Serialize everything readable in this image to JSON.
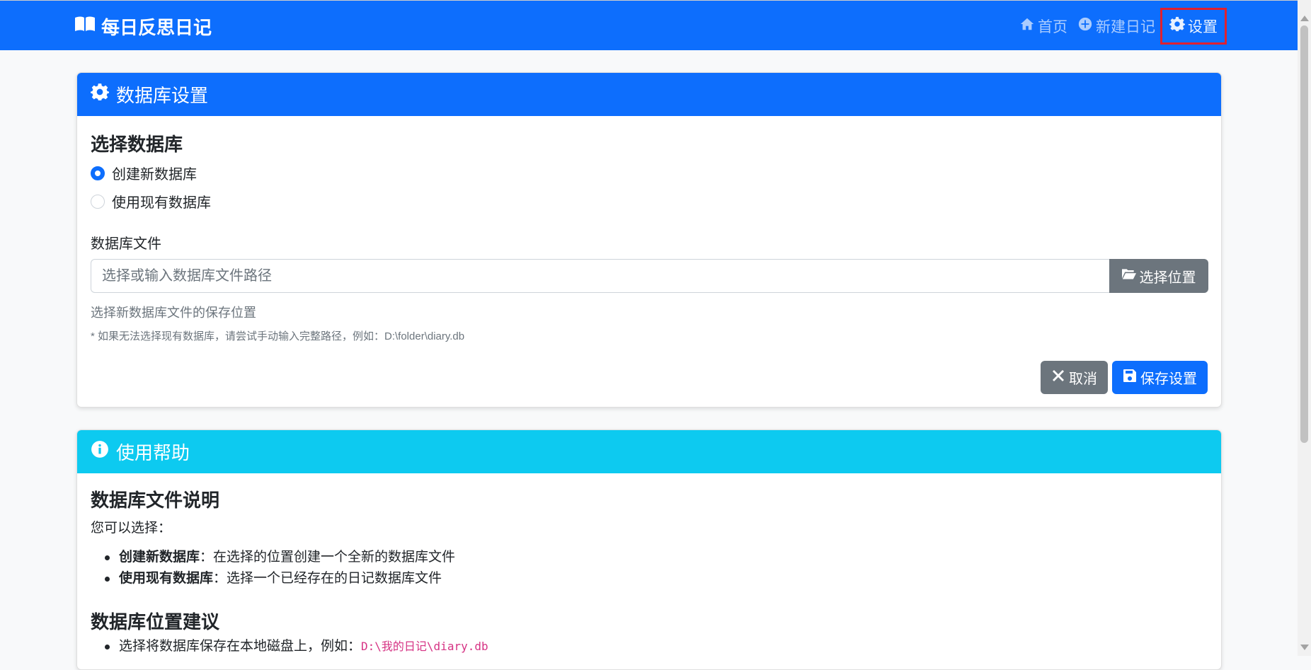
{
  "navbar": {
    "brand": "每日反思日记",
    "links": [
      {
        "label": "首页",
        "icon": "home-icon"
      },
      {
        "label": "新建日记",
        "icon": "plus-circle-icon"
      },
      {
        "label": "设置",
        "icon": "gear-icon",
        "active": true
      }
    ]
  },
  "settings_card": {
    "title": "数据库设置",
    "section_title": "选择数据库",
    "options": [
      {
        "label": "创建新数据库",
        "checked": true
      },
      {
        "label": "使用现有数据库",
        "checked": false
      }
    ],
    "file_label": "数据库文件",
    "file_placeholder": "选择或输入数据库文件路径",
    "choose_button": "选择位置",
    "help_text": "选择新数据库文件的保存位置",
    "note": "* 如果无法选择现有数据库，请尝试手动输入完整路径，例如：D:\\folder\\diary.db",
    "cancel_button": "取消",
    "save_button": "保存设置"
  },
  "help_card": {
    "title": "使用帮助",
    "section1_title": "数据库文件说明",
    "section1_intro": "您可以选择：",
    "items": [
      {
        "bold": "创建新数据库",
        "text": "：在选择的位置创建一个全新的数据库文件"
      },
      {
        "bold": "使用现有数据库",
        "text": "：选择一个已经存在的日记数据库文件"
      }
    ],
    "section2_title": "数据库位置建议",
    "section2_item": "选择将数据库保存在本地磁盘上，例如：",
    "section2_code": "D:\\我的日记\\diary.db"
  },
  "colors": {
    "primary": "#0d6efd",
    "info": "#0dcaf0",
    "secondary": "#6c757d",
    "highlight_border": "#e0202f"
  }
}
